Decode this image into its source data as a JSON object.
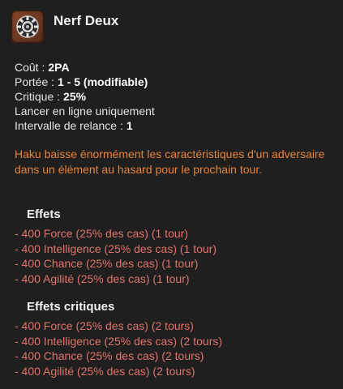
{
  "spell": {
    "name": "Nerf Deux",
    "icon": "gear-wheel-spell-icon",
    "icon_color": "#7a4127"
  },
  "stats": [
    {
      "label": "Coût :",
      "value": "2PA"
    },
    {
      "label": "Portée :",
      "value": "1 - 5 (modifiable)"
    },
    {
      "label": "Critique :",
      "value": "25%"
    },
    {
      "label": "Lancer en ligne uniquement",
      "value": ""
    },
    {
      "label": "Intervalle de relance :",
      "value": "1"
    }
  ],
  "description": "Haku baisse énormément les caractéristiques d'un adversaire dans un élément au hasard pour le prochain tour.",
  "effects": {
    "title": "Effets",
    "items": [
      "- 400 Force (25% des cas) (1 tour)",
      "- 400 Intelligence (25% des cas) (1 tour)",
      "- 400 Chance (25% des cas) (1 tour)",
      "- 400 Agilité (25% des cas) (1 tour)"
    ]
  },
  "critical_effects": {
    "title": "Effets critiques",
    "items": [
      "- 400 Force (25% des cas) (2 tours)",
      "- 400 Intelligence (25% des cas) (2 tours)",
      "- 400 Chance (25% des cas) (2 tours)",
      "- 400 Agilité (25% des cas) (2 tours)"
    ]
  },
  "colors": {
    "background": "#1f1f1f",
    "description": "#e8833a",
    "effect": "#e0736a",
    "title": "#f2f2f2"
  }
}
